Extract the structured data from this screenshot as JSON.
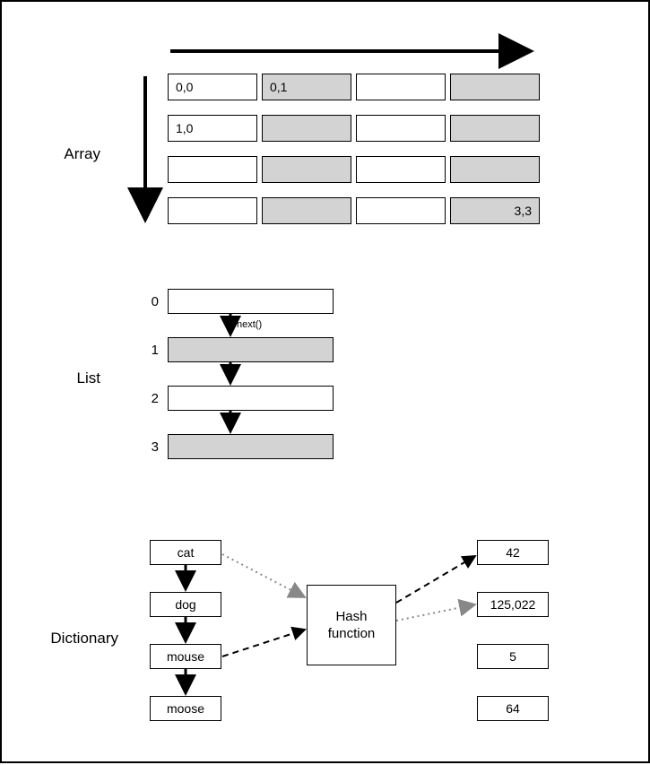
{
  "labels": {
    "array": "Array",
    "list": "List",
    "dictionary": "Dictionary",
    "next": "next()",
    "hash": "Hash\nfunction"
  },
  "array": {
    "rows": 4,
    "cols": 4,
    "cells": {
      "r0c0": "0,0",
      "r0c1": "0,1",
      "r1c0": "1,0",
      "r3c3": "3,3"
    }
  },
  "list": {
    "indices": [
      "0",
      "1",
      "2",
      "3"
    ]
  },
  "dictionary": {
    "keys": [
      "cat",
      "dog",
      "mouse",
      "moose"
    ],
    "values": [
      "42",
      "125,022",
      "5",
      "64"
    ]
  }
}
